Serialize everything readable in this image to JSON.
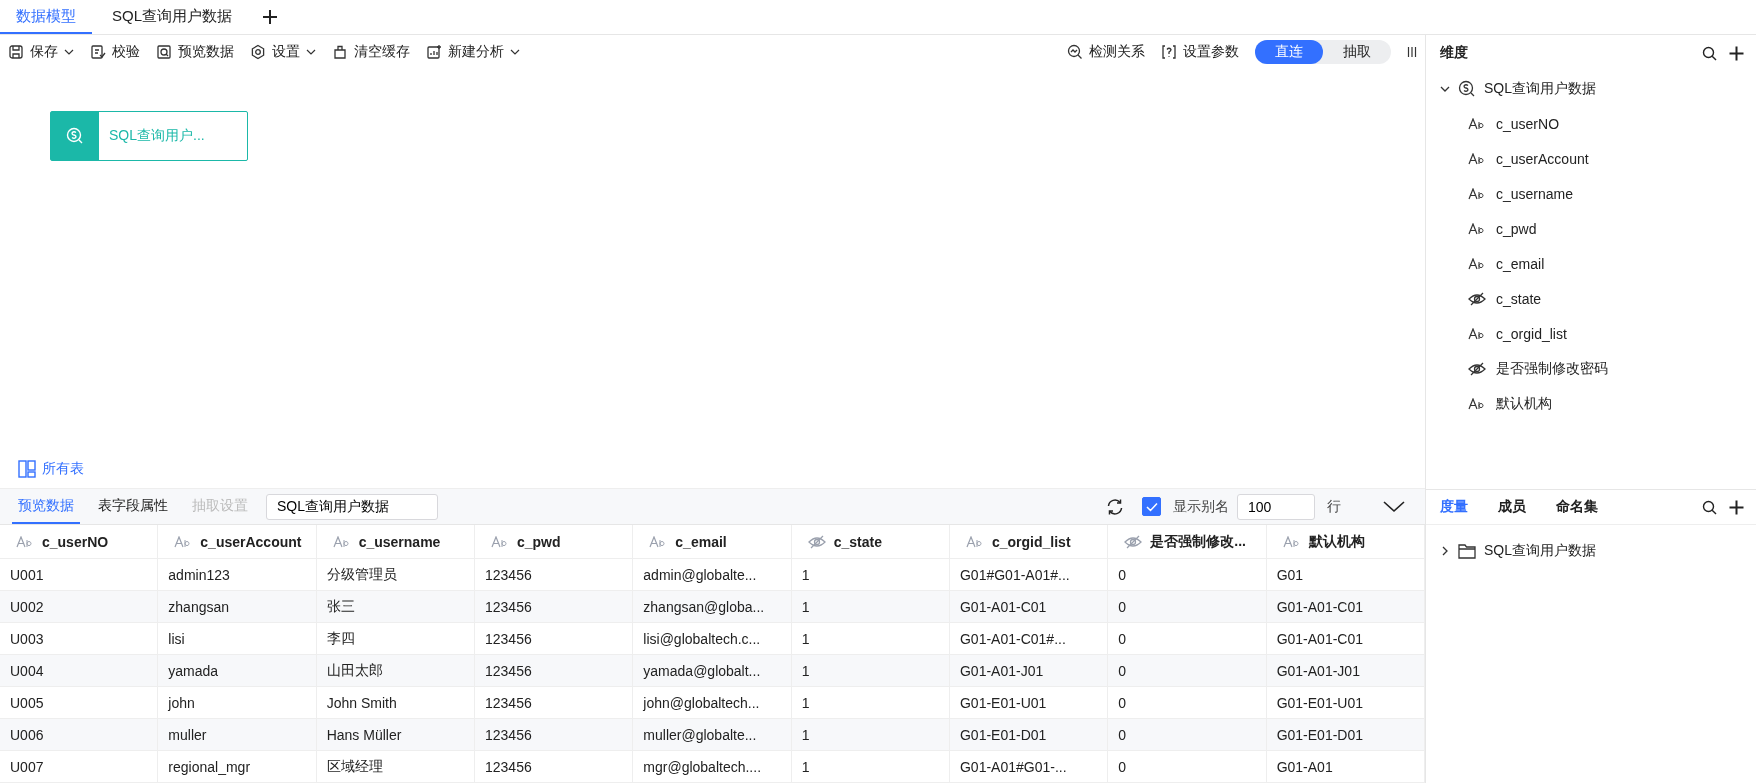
{
  "tabs": [
    {
      "label": "数据模型",
      "selected": true
    },
    {
      "label": "SQL查询用户数据",
      "selected": false
    }
  ],
  "toolbar": [
    {
      "label": "保存",
      "dropdown": true
    },
    {
      "label": "校验",
      "dropdown": false
    },
    {
      "label": "预览数据",
      "dropdown": false
    },
    {
      "label": "设置",
      "dropdown": true
    },
    {
      "label": "清空缓存",
      "dropdown": false
    },
    {
      "label": "新建分析",
      "dropdown": true
    }
  ],
  "toolbar_right": [
    {
      "label": "检测关系"
    },
    {
      "label": "设置参数"
    }
  ],
  "mode_toggle": [
    {
      "label": "直连",
      "selected": true
    },
    {
      "label": "抽取",
      "selected": false
    }
  ],
  "canvas_node": {
    "label": "SQL查询用户..."
  },
  "all_tables_link": "所有表",
  "bottom_tabs": [
    {
      "label": "预览数据",
      "selected": true,
      "disabled": false
    },
    {
      "label": "表字段属性",
      "selected": false,
      "disabled": false
    },
    {
      "label": "抽取设置",
      "selected": false,
      "disabled": true
    }
  ],
  "table_name_field": {
    "value": "SQL查询用户数据"
  },
  "show_alias": {
    "label": "显示别名",
    "checked": true
  },
  "row_limit": {
    "value": "100",
    "unit": "行"
  },
  "table": {
    "columns": [
      {
        "label": "c_userNO",
        "kind": "text"
      },
      {
        "label": "c_userAccount",
        "kind": "text"
      },
      {
        "label": "c_username",
        "kind": "text"
      },
      {
        "label": "c_pwd",
        "kind": "text"
      },
      {
        "label": "c_email",
        "kind": "text"
      },
      {
        "label": "c_state",
        "kind": "hidden"
      },
      {
        "label": "c_orgid_list",
        "kind": "text"
      },
      {
        "label": "是否强制修改...",
        "kind": "hidden"
      },
      {
        "label": "默认机构",
        "kind": "text"
      }
    ],
    "rows": [
      [
        "U001",
        "admin123",
        "分级管理员",
        "123456",
        "admin@globalte...",
        "1",
        "G01#G01-A01#...",
        "0",
        "G01"
      ],
      [
        "U002",
        "zhangsan",
        "张三",
        "123456",
        "zhangsan@globa...",
        "1",
        "G01-A01-C01",
        "0",
        "G01-A01-C01"
      ],
      [
        "U003",
        "lisi",
        "李四",
        "123456",
        "lisi@globaltech.c...",
        "1",
        "G01-A01-C01#...",
        "0",
        "G01-A01-C01"
      ],
      [
        "U004",
        "yamada",
        "山田太郎",
        "123456",
        "yamada@globalt...",
        "1",
        "G01-A01-J01",
        "0",
        "G01-A01-J01"
      ],
      [
        "U005",
        "john",
        "John Smith",
        "123456",
        "john@globaltech...",
        "1",
        "G01-E01-U01",
        "0",
        "G01-E01-U01"
      ],
      [
        "U006",
        "muller",
        "Hans Müller",
        "123456",
        "muller@globalte...",
        "1",
        "G01-E01-D01",
        "0",
        "G01-E01-D01"
      ],
      [
        "U007",
        "regional_mgr",
        "区域经理",
        "123456",
        "mgr@globaltech....",
        "1",
        "G01-A01#G01-...",
        "0",
        "G01-A01"
      ]
    ]
  },
  "dimension_panel": {
    "title": "维度",
    "tree": [
      {
        "label": "SQL查询用户数据",
        "expanded": true,
        "children": [
          {
            "label": "c_userNO",
            "kind": "text"
          },
          {
            "label": "c_userAccount",
            "kind": "text"
          },
          {
            "label": "c_username",
            "kind": "text"
          },
          {
            "label": "c_pwd",
            "kind": "text"
          },
          {
            "label": "c_email",
            "kind": "text"
          },
          {
            "label": "c_state",
            "kind": "hidden"
          },
          {
            "label": "c_orgid_list",
            "kind": "text"
          },
          {
            "label": "是否强制修改密码",
            "kind": "hidden"
          },
          {
            "label": "默认机构",
            "kind": "text"
          }
        ]
      }
    ]
  },
  "measure_panel": {
    "tabs": [
      {
        "label": "度量",
        "selected": true
      },
      {
        "label": "成员",
        "selected": false
      },
      {
        "label": "命名集",
        "selected": false
      }
    ],
    "tree": [
      {
        "label": "SQL查询用户数据",
        "expanded": false
      }
    ]
  }
}
